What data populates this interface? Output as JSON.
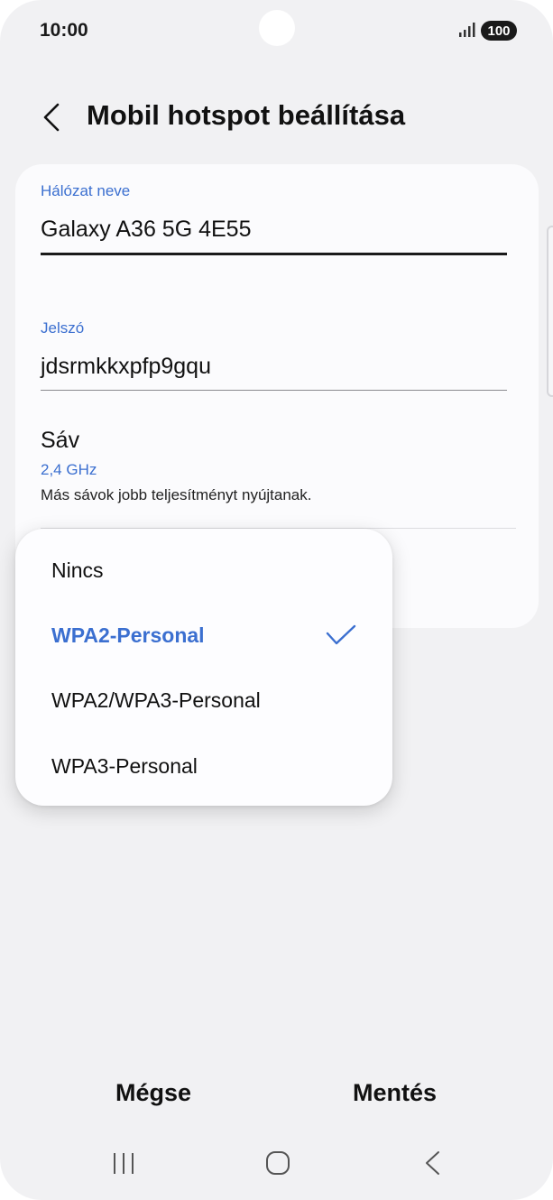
{
  "status_bar": {
    "time": "10:00",
    "battery": "100",
    "signal_icon": "signal-icon"
  },
  "header": {
    "title": "Mobil hotspot beállítása",
    "back_icon": "chevron-left-icon"
  },
  "form": {
    "network_name_label": "Hálózat neve",
    "network_name_value": "Galaxy A36 5G 4E55",
    "password_label": "Jelszó",
    "password_value": "jdsrmkkxpfp9gqu",
    "band_title": "Sáv",
    "band_value": "2,4 GHz",
    "band_description": "Más sávok jobb teljesítményt nyújtanak."
  },
  "security_dropdown": {
    "options": [
      "Nincs",
      "WPA2-Personal",
      "WPA2/WPA3-Personal",
      "WPA3-Personal"
    ],
    "selected": "WPA2-Personal"
  },
  "actions": {
    "cancel_label": "Mégse",
    "save_label": "Mentés"
  },
  "colors": {
    "accent": "#3b6fd0",
    "background": "#f1f1f3",
    "card": "#fbfbfd"
  }
}
